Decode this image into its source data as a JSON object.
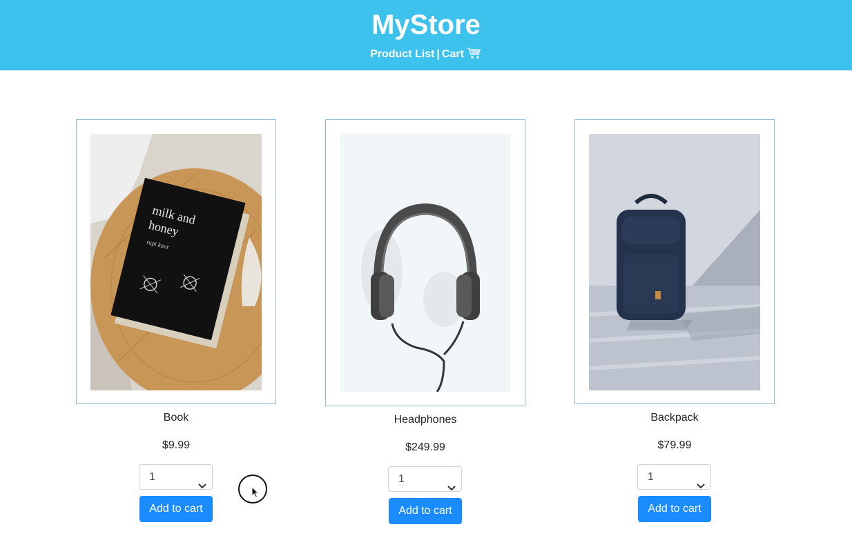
{
  "header": {
    "brand": "MyStore",
    "nav_product_list": "Product List",
    "nav_separator": "|",
    "nav_cart": "Cart",
    "cart_icon": "shopping-cart-icon"
  },
  "colors": {
    "header_bg": "#3cc2ec",
    "button_bg": "#1a8cff",
    "card_border": "#8fb8d6"
  },
  "products": [
    {
      "name": "Book",
      "price": "$9.99",
      "quantity": "1",
      "button": "Add to cart",
      "image": "book-photo"
    },
    {
      "name": "Headphones",
      "price": "$249.99",
      "quantity": "1",
      "button": "Add to cart",
      "image": "headphones-photo"
    },
    {
      "name": "Backpack",
      "price": "$79.99",
      "quantity": "1",
      "button": "Add to cart",
      "image": "backpack-photo"
    }
  ]
}
